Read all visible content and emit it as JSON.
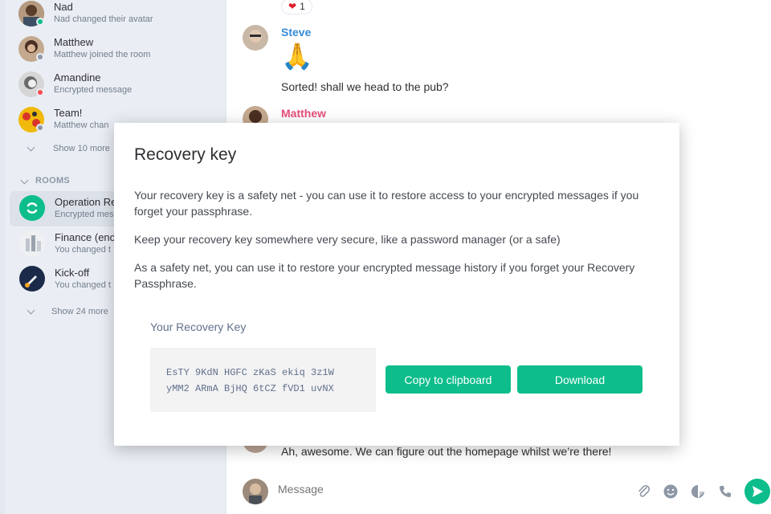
{
  "sidebar": {
    "dms": [
      {
        "name": "Nad",
        "sub": "Nad changed their avatar",
        "presence": "online"
      },
      {
        "name": "Matthew",
        "sub": "Matthew joined the room",
        "presence": "offline"
      },
      {
        "name": "Amandine",
        "sub": "Encrypted message",
        "presence": "busy"
      },
      {
        "name": "Team!",
        "sub": "Matthew chan",
        "presence": "offline"
      }
    ],
    "dm_show_more": "Show 10 more",
    "rooms_header": "ROOMS",
    "rooms": [
      {
        "name": "Operation Re",
        "sub": "Encrypted mes",
        "active": true
      },
      {
        "name": "Finance (enc",
        "sub": "You changed t",
        "active": false
      },
      {
        "name": "Kick-off",
        "sub": "You changed t",
        "active": false
      }
    ],
    "rooms_show_more": "Show 24 more"
  },
  "timeline": {
    "reaction": {
      "emoji": "heart",
      "count": "1"
    },
    "messages": [
      {
        "sender": "Steve",
        "sender_color": "#368bd6",
        "emoji": "🙏",
        "text": "Sorted! shall we head to the pub?"
      },
      {
        "sender": "Matthew",
        "sender_color": "#e64f7a"
      },
      {
        "text": "Ah, awesome. We can figure out the homepage whilst we’re there!"
      }
    ],
    "composer_placeholder": "Message"
  },
  "dialog": {
    "title": "Recovery key",
    "p1": "Your recovery key is a safety net - you can use it to restore access to your encrypted messages if you forget your passphrase.",
    "p2": "Keep your recovery key somewhere very secure, like a password manager (or a safe)",
    "p3": "As a safety net, you can use it to restore your encrypted message history if you forget your Recovery Passphrase.",
    "key_label": "Your Recovery Key",
    "key_line1": "EsTY 9KdN HGFC zKaS ekiq 3z1W",
    "key_line2": "yMM2 ARmA BjHQ 6tCZ fVD1 uvNX",
    "copy_button": "Copy to clipboard",
    "download_button": "Download"
  },
  "colors": {
    "accent": "#0dbd8b",
    "steve": "#368bd6",
    "matthew": "#e64f7a"
  }
}
